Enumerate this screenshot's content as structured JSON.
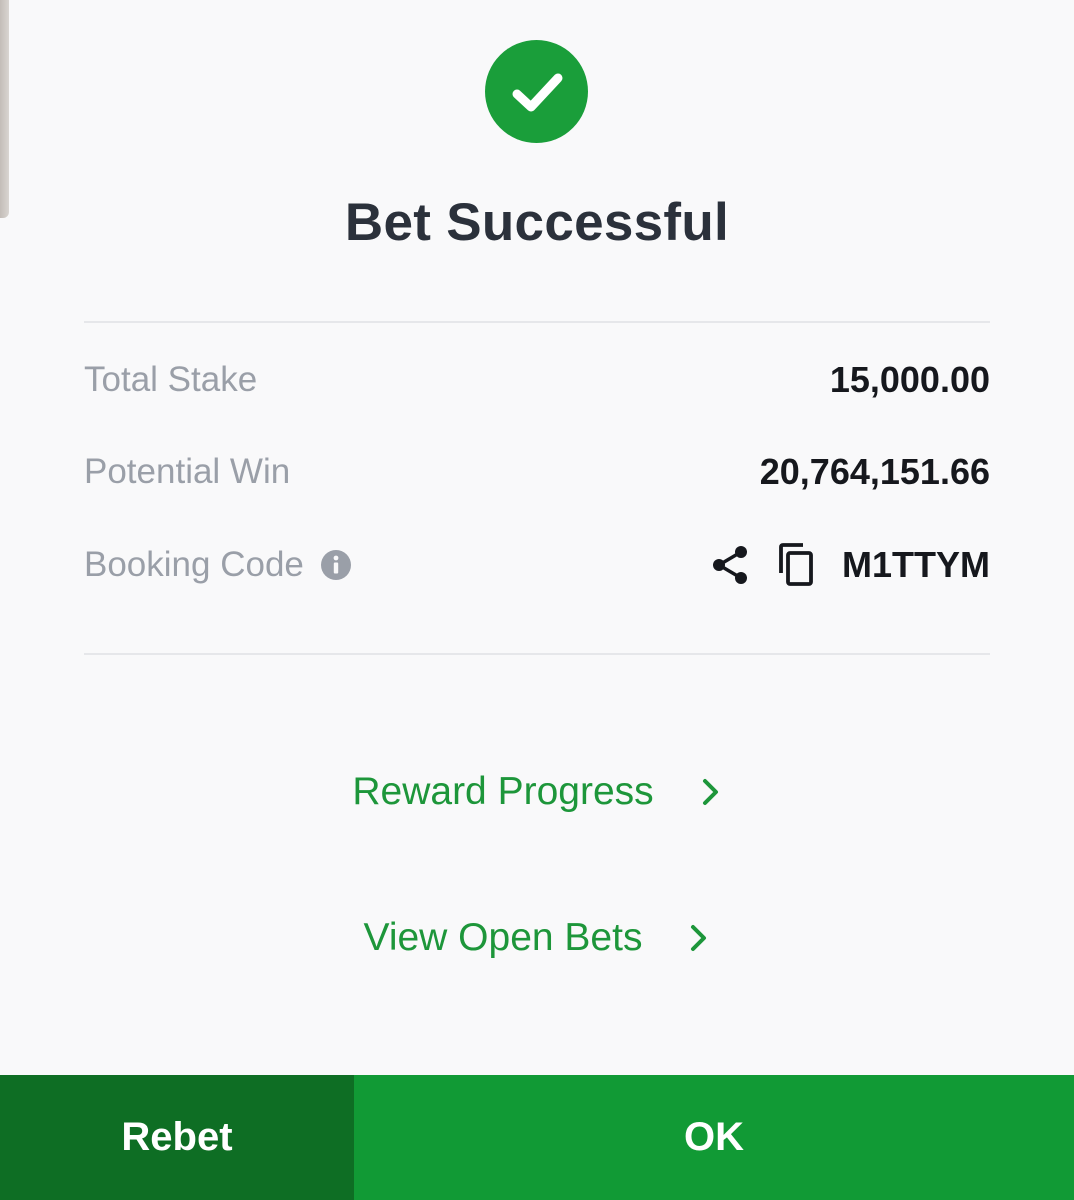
{
  "header": {
    "title": "Bet Successful"
  },
  "summary": {
    "rows": [
      {
        "label": "Total Stake",
        "value": "15,000.00"
      },
      {
        "label": "Potential Win",
        "value": "20,764,151.66"
      },
      {
        "label": "Booking Code",
        "value": "M1TTYM"
      }
    ]
  },
  "links": {
    "reward_progress": "Reward Progress",
    "view_open_bets": "View Open Bets"
  },
  "footer": {
    "rebet_label": "Rebet",
    "ok_label": "OK"
  },
  "icons": {
    "success": "check-circle-icon",
    "info": "info-icon",
    "share": "share-icon",
    "copy": "copy-icon",
    "chevron": "chevron-right-icon"
  },
  "colors": {
    "brand_green": "#1a9e3a",
    "rebet_green": "#0e6e24",
    "ok_green": "#119a35",
    "link_green": "#1d963a",
    "title_text": "#2b313b",
    "label_text": "#9a9fa8"
  }
}
